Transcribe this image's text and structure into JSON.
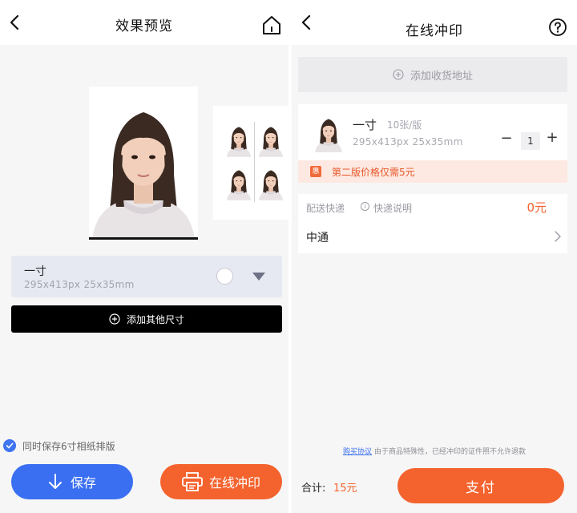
{
  "left_screen": {
    "header": {
      "title": "效果预览",
      "back_icon": "chevron-left-icon",
      "home_icon": "home-icon"
    },
    "size_card": {
      "name": "一寸",
      "dims": "295x413px   25x35mm",
      "dropdown_icon": "caret-down-icon"
    },
    "add_size_button": {
      "label": "添加其他尺寸",
      "icon": "plus-circle-icon"
    },
    "sync_option": {
      "label": "同时保存6寸相纸排版",
      "checked": true
    },
    "save_button": {
      "label": "保存",
      "icon": "download-icon"
    },
    "print_button": {
      "label": "在线冲印",
      "icon": "printer-icon"
    }
  },
  "right_screen": {
    "header": {
      "title": "在线冲印",
      "back_icon": "chevron-left-icon",
      "help_icon": "help-circle-icon"
    },
    "address": {
      "label": "添加收货地址",
      "icon": "plus-circle-icon"
    },
    "order": {
      "name": "一寸",
      "sheets": "10张/版",
      "dims": "295x413px   25x35mm",
      "quantity": "1",
      "minus": "−",
      "plus": "+",
      "promo_icon_text": "惠",
      "promo": "第二版价格仅需5元"
    },
    "shipping": {
      "label": "配送快递",
      "info_icon_text": "i",
      "info_label": "快递说明",
      "fee": "0元",
      "courier": "中通"
    },
    "agreement": {
      "link": "购买协议",
      "text": "由于商品特殊性，已经冲印的证件照不允许退款"
    },
    "total": {
      "label": "合计:",
      "value": "15元"
    },
    "pay_button": {
      "label": "支付"
    }
  },
  "colors": {
    "accent_orange": "#f4632e",
    "accent_blue": "#3a6ff2",
    "promo_bg": "#fde9e1",
    "card_lavender": "#e7e9f2"
  }
}
